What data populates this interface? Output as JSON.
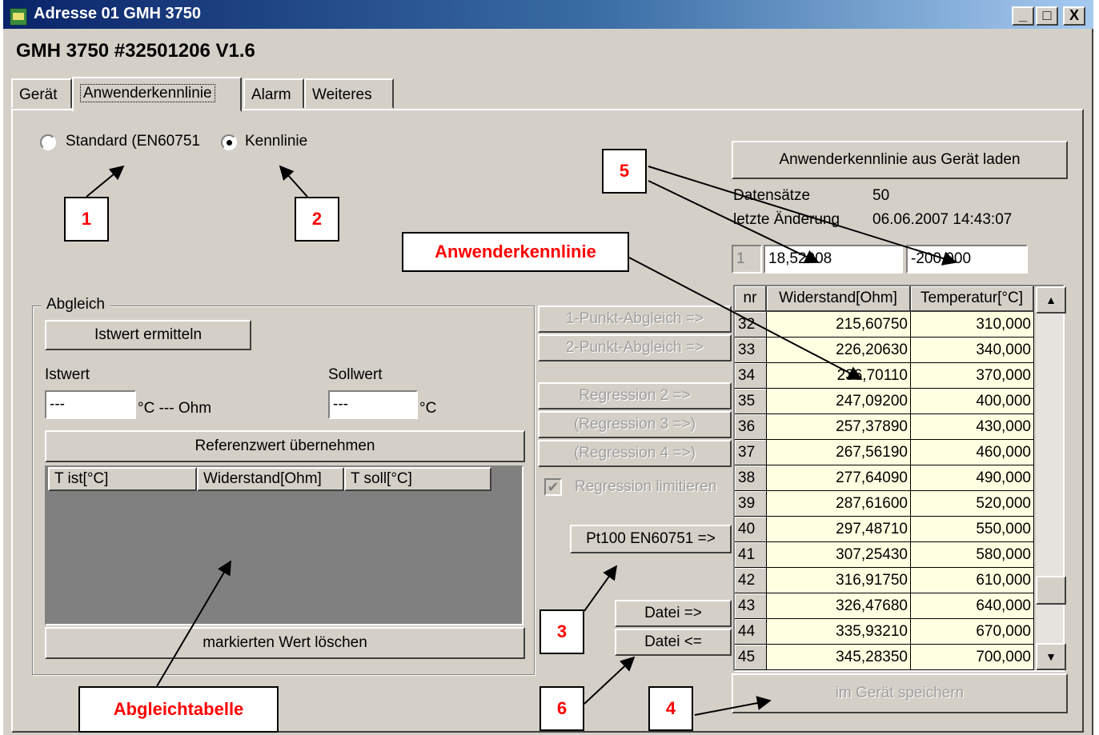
{
  "window": {
    "title": "Adresse 01 GMH 3750",
    "subtitle": "GMH 3750 #32501206 V1.6",
    "min_label": "_",
    "max_label": "□",
    "close_label": "X"
  },
  "tabs": [
    {
      "label": "Gerät"
    },
    {
      "label": "Anwenderkennlinie"
    },
    {
      "label": "Alarm"
    },
    {
      "label": "Weiteres"
    }
  ],
  "mode": {
    "standard_label": "Standard (EN60751",
    "kennlinie_label": "Kennlinie",
    "selected": "Kennlinie"
  },
  "abgleich": {
    "group_label": "Abgleich",
    "istwert_button": "Istwert ermitteln",
    "istwert_label": "Istwert",
    "istwert_value": "---",
    "istwert_unit": "°C --- Ohm",
    "sollwert_label": "Sollwert",
    "sollwert_value": "---",
    "sollwert_unit": "°C",
    "referenz_button": "Referenzwert übernehmen",
    "columns": [
      "T ist[°C]",
      "Widerstand[Ohm]",
      "T soll[°C]"
    ],
    "delete_button": "markierten Wert löschen"
  },
  "actions": {
    "punkt1": "1-Punkt-Abgleich =>",
    "punkt2": "2-Punkt-Abgleich =>",
    "regression2": "Regression 2 =>",
    "regression3": "(Regression 3 =>)",
    "regression4": "(Regression 4 =>)",
    "regression_limit": "Regression limitieren",
    "regression_limit_checked": true,
    "pt100": "Pt100 EN60751 =>",
    "datei_out": "Datei =>",
    "datei_in": "Datei <=",
    "save": "im Gerät speichern"
  },
  "kennlinie": {
    "load_button": "Anwenderkennlinie aus Gerät laden",
    "datensaetze_label": "Datensätze",
    "datensaetze_value": "50",
    "last_change_label": "letzte Änderung",
    "last_change_value": "06.06.2007 14:43:07",
    "edit_index": "1",
    "edit_resistance": "18,52008",
    "edit_temperature": "-200,000",
    "columns": [
      "nr",
      "Widerstand[Ohm]",
      "Temperatur[°C]"
    ],
    "rows": [
      {
        "nr": "32",
        "r": "215,60750",
        "t": "310,000"
      },
      {
        "nr": "33",
        "r": "226,20630",
        "t": "340,000"
      },
      {
        "nr": "34",
        "r": "236,70110",
        "t": "370,000"
      },
      {
        "nr": "35",
        "r": "247,09200",
        "t": "400,000"
      },
      {
        "nr": "36",
        "r": "257,37890",
        "t": "430,000"
      },
      {
        "nr": "37",
        "r": "267,56190",
        "t": "460,000"
      },
      {
        "nr": "38",
        "r": "277,64090",
        "t": "490,000"
      },
      {
        "nr": "39",
        "r": "287,61600",
        "t": "520,000"
      },
      {
        "nr": "40",
        "r": "297,48710",
        "t": "550,000"
      },
      {
        "nr": "41",
        "r": "307,25430",
        "t": "580,000"
      },
      {
        "nr": "42",
        "r": "316,91750",
        "t": "610,000"
      },
      {
        "nr": "43",
        "r": "326,47680",
        "t": "640,000"
      },
      {
        "nr": "44",
        "r": "335,93210",
        "t": "670,000"
      },
      {
        "nr": "45",
        "r": "345,28350",
        "t": "700,000"
      }
    ],
    "scroll_up": "▲",
    "scroll_down": "▼"
  },
  "annotations": {
    "n1": "1",
    "n2": "2",
    "n3": "3",
    "n4": "4",
    "n5": "5",
    "n6": "6",
    "anwenderkennlinie": "Anwenderkennlinie",
    "abgleichtabelle": "Abgleichtabelle",
    "text_color": "#ff0000"
  }
}
